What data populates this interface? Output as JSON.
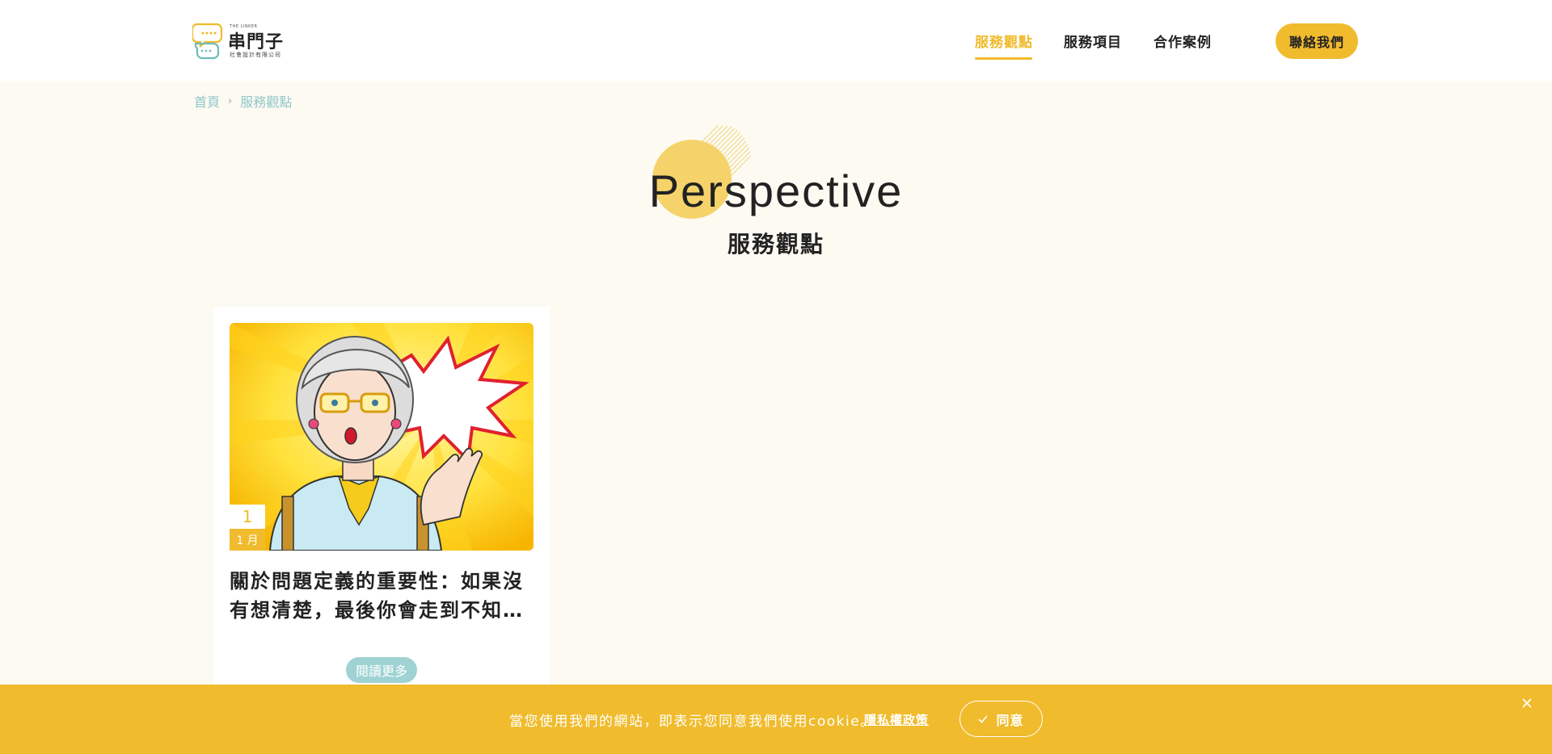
{
  "header": {
    "logo": {
      "small_top": "THE LINKER",
      "main": "串門子",
      "sub": "社會設計有限公司"
    },
    "nav": [
      {
        "label": "服務觀點",
        "active": true
      },
      {
        "label": "服務項目",
        "active": false
      },
      {
        "label": "合作案例",
        "active": false
      }
    ],
    "contact_label": "聯絡我們"
  },
  "breadcrumb": [
    "首頁",
    "服務觀點"
  ],
  "title": {
    "en": "Perspective",
    "zh": "服務觀點"
  },
  "cards": [
    {
      "day": "1",
      "month": "1 月",
      "title_line1": "關於問題定義的重要性：如果沒",
      "title_line2": "有想清楚，最後你會走到不知…",
      "read_more": "閱讀更多"
    }
  ],
  "cookie": {
    "text": "當您使用我們的網站，即表示您同意我們使用cookie。",
    "link": "隱私權政策",
    "agree": "同意"
  },
  "colors": {
    "accent": "#f0bb2c",
    "teal": "#9fd3d3",
    "background": "#fdfaf2"
  }
}
